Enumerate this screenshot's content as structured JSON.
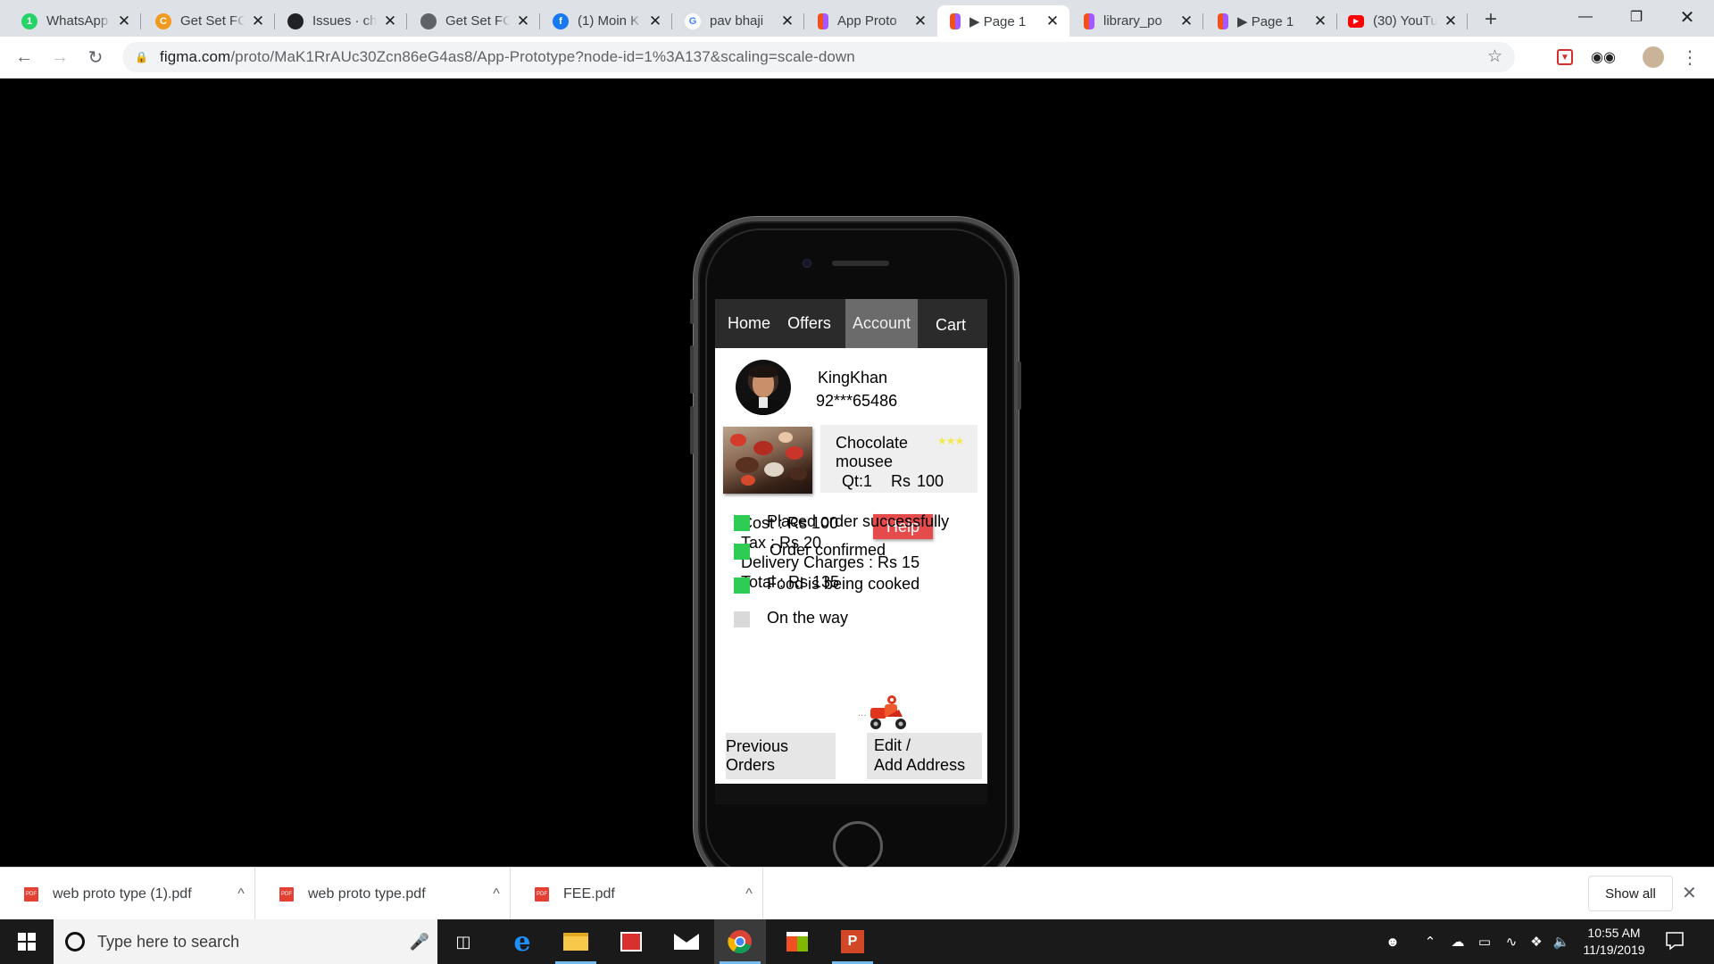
{
  "browser": {
    "tabs": [
      {
        "title": "WhatsApp",
        "icon": "whatsapp-icon",
        "color": "#25d366",
        "glyph": "1"
      },
      {
        "title": "Get Set FC",
        "icon": "getset-icon",
        "color": "#f29a1f",
        "glyph": "C"
      },
      {
        "title": "Issues · ch",
        "icon": "github-icon",
        "color": "#202124",
        "glyph": ""
      },
      {
        "title": "Get Set FC",
        "icon": "globe-icon",
        "color": "#5f6368",
        "glyph": ""
      },
      {
        "title": "(1) Moin K",
        "icon": "facebook-icon",
        "color": "#1877f2",
        "glyph": "f"
      },
      {
        "title": "pav bhaji",
        "icon": "google-icon",
        "color": "#4285f4",
        "glyph": "G"
      },
      {
        "title": "App Proto",
        "icon": "figma-icon",
        "color": "#f24e1e",
        "glyph": ""
      },
      {
        "title": "▶ Page 1",
        "icon": "figma-icon",
        "color": "#f24e1e",
        "glyph": ""
      },
      {
        "title": "library_po",
        "icon": "figma-icon",
        "color": "#f24e1e",
        "glyph": ""
      },
      {
        "title": "▶ Page 1",
        "icon": "figma-icon",
        "color": "#f24e1e",
        "glyph": ""
      },
      {
        "title": "(30) YouTu",
        "icon": "youtube-icon",
        "color": "#ff0000",
        "glyph": "▶"
      }
    ],
    "active_tab": 7,
    "url_host": "figma.com",
    "url_path": "/proto/MaK1RrAUc30Zcn86eG4as8/App-Prototype?node-id=1%3A137&scaling=scale-down"
  },
  "app": {
    "nav": [
      "Home",
      "Offers",
      "Account",
      "Cart"
    ],
    "active_nav": "Account",
    "user": {
      "name": "KingKhan",
      "phone": "92***65486"
    },
    "order": {
      "name": "Chocolate mousee",
      "qty": "Qt:1",
      "price": "Rs 100",
      "stars": "★★★",
      "rating": 3
    },
    "bill": {
      "cost": "Cost : Rs 100",
      "tax": "Tax : Rs 20",
      "delivery": "Delivery Charges : Rs 15",
      "total": "Total : Rs 135"
    },
    "help_label": "Help",
    "statuses": [
      {
        "label": "Placed order successfully",
        "done": true
      },
      {
        "label": "Order confirmed",
        "done": true
      },
      {
        "label": "Food is being cooked",
        "done": true
      },
      {
        "label": "On the way",
        "done": false
      }
    ],
    "status_colors": {
      "done": "#2ecc55",
      "pending": "#d9d9d9"
    },
    "buttons": {
      "previous_orders": "Previous Orders",
      "edit_line1": "Edit /",
      "edit_line2": "Add Address"
    }
  },
  "downloads": {
    "items": [
      "web proto type (1).pdf",
      "web proto type.pdf",
      "FEE.pdf"
    ],
    "show_all": "Show all"
  },
  "taskbar": {
    "search_placeholder": "Type here to search",
    "time": "10:55 AM",
    "date": "11/19/2019"
  }
}
